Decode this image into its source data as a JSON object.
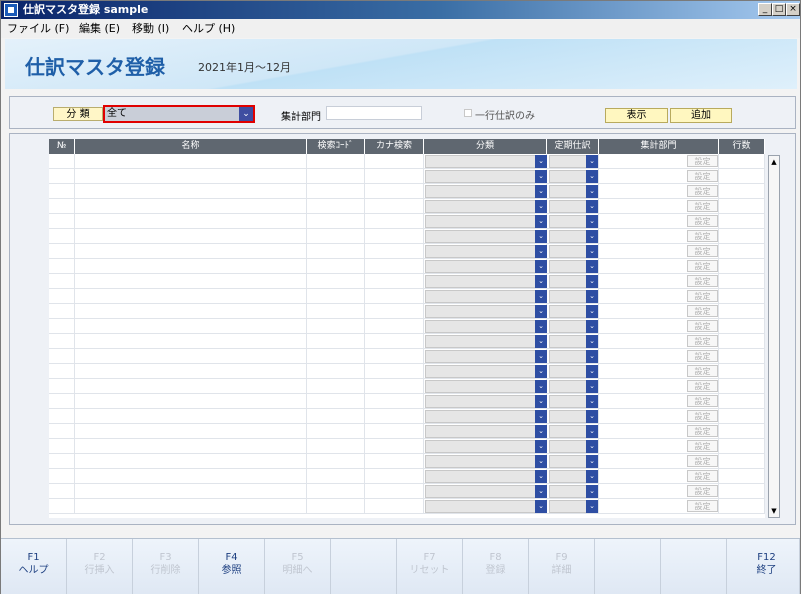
{
  "window": {
    "title": "仕訳マスタ登録 sample",
    "min": "_",
    "max": "□",
    "close": "×"
  },
  "menu": {
    "file": "ファイル (F)",
    "edit": "編集 (E)",
    "move": "移動 (I)",
    "help": "ヘルプ (H)"
  },
  "header": {
    "title": "仕訳マスタ登録",
    "period": "2021年1月～12月"
  },
  "filter": {
    "category_label": "分 類",
    "category_value": "全て",
    "dept_label": "集計部門",
    "dept_value": "",
    "single_line_label": "一行仕訳のみ",
    "single_line_checked": false,
    "show_button": "表示",
    "add_button": "追加"
  },
  "grid": {
    "columns": [
      "№",
      "名称",
      "検索ｺｰﾄﾞ",
      "カナ検索",
      "分類",
      "定期仕訳",
      "集計部門",
      "行数"
    ],
    "set_label": "設定",
    "row_count": 24,
    "rows": []
  },
  "fkeys": [
    {
      "key": "F1",
      "label": "ヘルプ",
      "enabled": true
    },
    {
      "key": "F2",
      "label": "行挿入",
      "enabled": false
    },
    {
      "key": "F3",
      "label": "行削除",
      "enabled": false
    },
    {
      "key": "F4",
      "label": "参照",
      "enabled": true
    },
    {
      "key": "F5",
      "label": "明細へ",
      "enabled": false
    },
    {
      "key": "",
      "label": "",
      "enabled": false
    },
    {
      "key": "F7",
      "label": "リセット",
      "enabled": false
    },
    {
      "key": "F8",
      "label": "登録",
      "enabled": false
    },
    {
      "key": "F9",
      "label": "詳細",
      "enabled": false
    },
    {
      "key": "",
      "label": "",
      "enabled": false
    },
    {
      "key": "",
      "label": "",
      "enabled": false
    },
    {
      "key": "F12",
      "label": "終了",
      "enabled": true
    }
  ],
  "colors": {
    "title_blue": "#1f5fa8",
    "selection_border": "#e00000",
    "dropdown_arrow": "#2e4ea3",
    "header_cell": "#5f6770"
  }
}
